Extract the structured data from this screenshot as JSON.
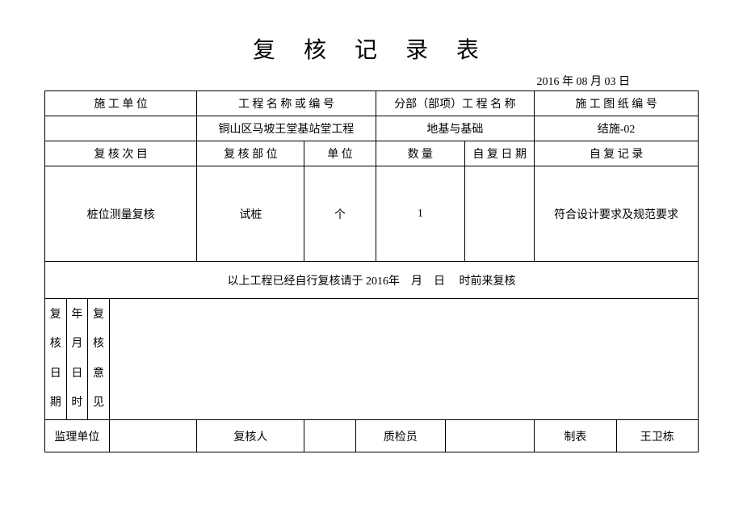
{
  "title": "复 核 记 录 表",
  "date": "2016 年 08 月 03 日",
  "headers": {
    "unit": "施 工 单 位",
    "projectName": "工 程 名 称 或 编 号",
    "subProjectName": "分部（部项）工 程 名 称",
    "drawingNo": "施 工 图 纸 编 号"
  },
  "row2": {
    "unit": "",
    "projectName": "铜山区马坡王堂基站堂工程",
    "subProjectName": "地基与基础",
    "drawingNo": "结施-02"
  },
  "headers2": {
    "item": "复 核 次 目",
    "part": "复 核 部 位",
    "unitMeasure": "单 位",
    "qty": "数 量",
    "selfDate": "自 复 日 期",
    "selfRecord": "自 复 记 录"
  },
  "row4": {
    "item": "桩位测量复核",
    "part": "试桩",
    "unitMeasure": "个",
    "qty": "1",
    "selfDate": "",
    "selfRecord": "符合设计要求及规范要求"
  },
  "notice": "以上工程已经自行复核请于 2016年　月　日　 时前来复核",
  "vertical": {
    "col1a": "复",
    "col1b": "核",
    "col1c": "日",
    "col1d": "期",
    "col2a": "年",
    "col2b": "月",
    "col2c": "日",
    "col2d": "时",
    "col3a": "复",
    "col3b": "核",
    "col3c": "意",
    "col3d": "见"
  },
  "footer": {
    "supervisionLabel": "监理单位",
    "supervisionValue": "",
    "reviewerLabel": "复核人",
    "reviewerValue": "",
    "inspectorLabel": "质检员",
    "inspectorValue": "",
    "preparerLabel": "制表",
    "preparerValue": "王卫栋"
  }
}
